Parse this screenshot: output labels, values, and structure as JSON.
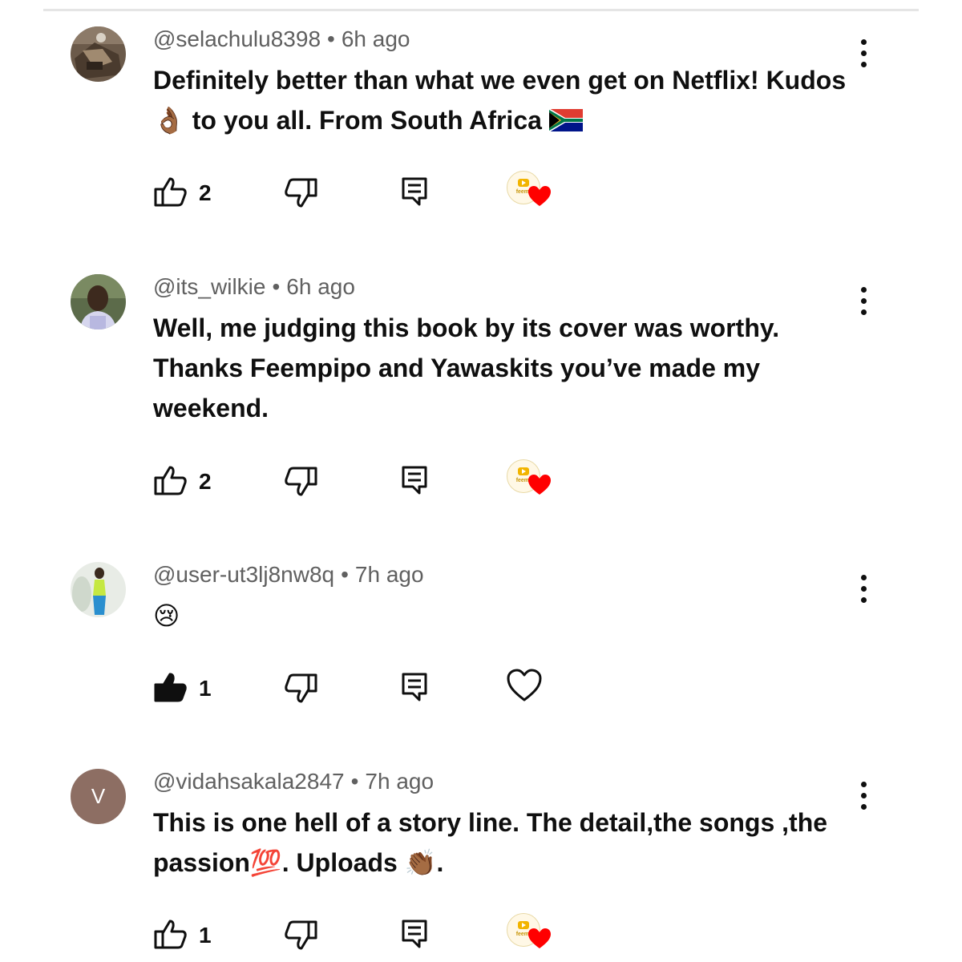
{
  "comments": [
    {
      "username": "@selachulu8398",
      "time": "6h ago",
      "text_lines": [
        "Definitely better than what we even get on Netflix! Kudos",
        "👌🏾 to you all. From South Africa"
      ],
      "like_count": "2",
      "liked": false,
      "creator_heart": true,
      "avatar": "photo"
    },
    {
      "username": "@its_wilkie",
      "time": "6h ago",
      "text_lines": [
        "Well, me judging this book by its cover was worthy.",
        "Thanks Feempipo and Yawaskits you’ve made my",
        "weekend."
      ],
      "like_count": "2",
      "liked": false,
      "creator_heart": true,
      "avatar": "photo"
    },
    {
      "username": "@user-ut3lj8nw8q",
      "time": "7h ago",
      "text_lines": [
        "😢"
      ],
      "like_count": "1",
      "liked": true,
      "creator_heart": false,
      "avatar": "photo"
    },
    {
      "username": "@vidahsakala2847",
      "time": "7h ago",
      "text_lines": [
        "This is one hell of a story line. The detail,the songs ,the",
        "passion💯. Uploads 👏🏾."
      ],
      "like_count": "1",
      "liked": false,
      "creator_heart": true,
      "avatar": "letter",
      "avatar_letter": "V"
    }
  ],
  "meta_separator": "•",
  "creator_badge_text": "feemp",
  "colors": {
    "heart_red": "#ff0000",
    "meta_gray": "#606060",
    "letter_avatar_bg": "#8d6e63",
    "creator_gold": "#f2b400"
  },
  "icons": [
    "thumbs-up-outline-icon",
    "thumbs-up-filled-icon",
    "thumbs-down-icon",
    "reply-icon",
    "more-vertical-icon",
    "heart-outline-icon",
    "creator-heart-icon",
    "south-africa-flag-icon"
  ]
}
